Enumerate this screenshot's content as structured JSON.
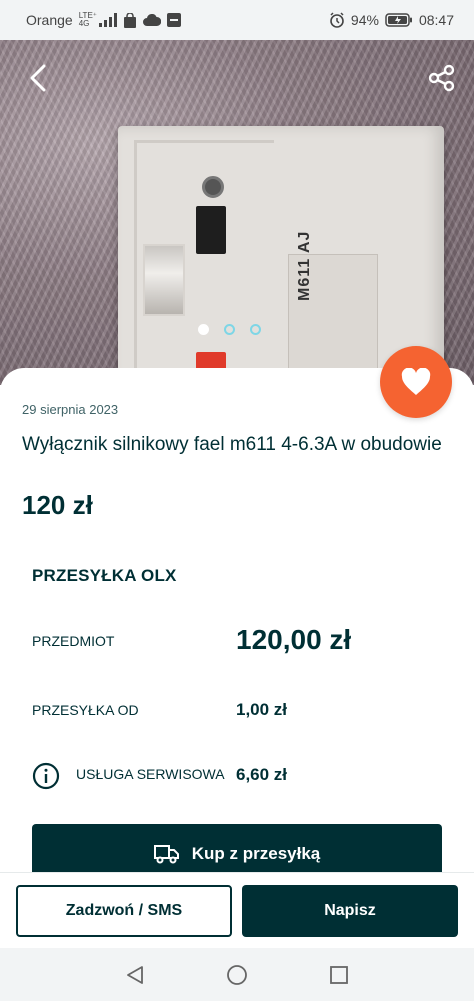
{
  "status_bar": {
    "carrier": "Orange",
    "network_tag": "LTE⁺",
    "network_sub": "4G",
    "battery_percent": "94%",
    "time": "08:47",
    "icons": [
      "signal-icon",
      "shopping-bag-icon",
      "cloud-icon",
      "notification-icon",
      "alarm-icon",
      "battery-icon"
    ]
  },
  "gallery": {
    "image_count": 3,
    "active_index": 0,
    "device_label": "M611 AJ"
  },
  "listing": {
    "date": "29 sierpnia 2023",
    "title": "Wyłącznik silnikowy fael m611 4-6.3A w obudowie",
    "price": "120 zł"
  },
  "shipping": {
    "section_title": "PRZESYŁKA OLX",
    "item_label": "PRZEDMIOT",
    "item_value": "120,00 zł",
    "shipping_label": "PRZESYŁKA OD",
    "shipping_value": "1,00 zł",
    "service_label": "USŁUGA SERWISOWA",
    "service_value": "6,60 zł",
    "buy_button": "Kup z przesyłką"
  },
  "actions": {
    "call_label": "Zadzwoń / SMS",
    "write_label": "Napisz"
  },
  "colors": {
    "brand_dark": "#002f34",
    "favorite_orange": "#f56331",
    "dot_teal": "#7ed6e6"
  }
}
